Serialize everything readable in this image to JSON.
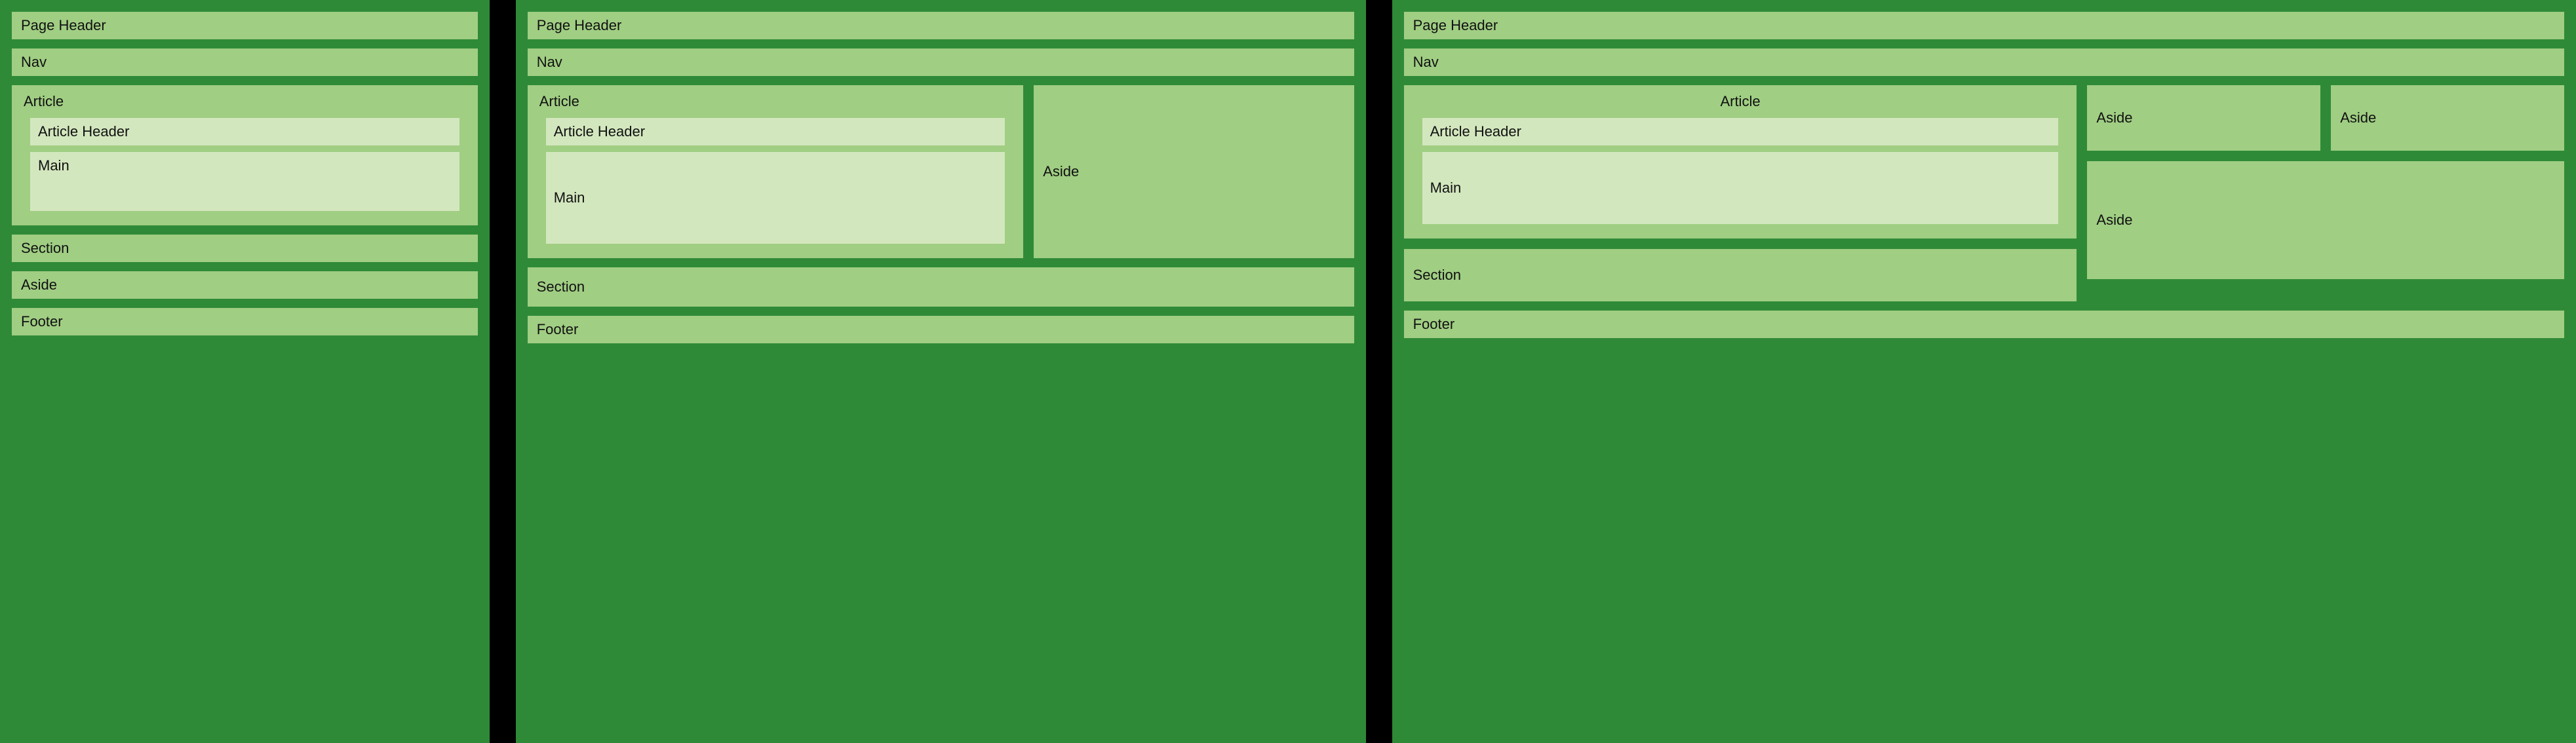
{
  "labels": {
    "pageHeader": "Page Header",
    "nav": "Nav",
    "article": "Article",
    "articleHeader": "Article Header",
    "main": "Main",
    "section": "Section",
    "aside": "Aside",
    "footer": "Footer"
  },
  "colors": {
    "panelBg": "#2f8a37",
    "blockBg": "#a0ce83",
    "innerBg": "#d3e7be",
    "divider": "#000000"
  },
  "diagram": {
    "description": "Three responsive layout wireframes showing how semantic page regions (header, nav, article with header and main, section, aside, footer) rearrange at narrow, medium, and wide viewport widths.",
    "panels": [
      {
        "width": "narrow",
        "stack": [
          "Page Header",
          "Nav",
          "Article(Article Header, Main)",
          "Section",
          "Aside",
          "Footer"
        ]
      },
      {
        "width": "medium",
        "stack": [
          "Page Header",
          "Nav",
          [
            "Article(Article Header, Main)",
            "Aside"
          ],
          "Section",
          "Footer"
        ]
      },
      {
        "width": "wide",
        "stack": [
          "Page Header",
          "Nav",
          [
            [
              "Article(Article Header, Main)",
              "Section"
            ],
            [
              [
                "Aside",
                "Aside"
              ],
              "Aside"
            ]
          ],
          "Footer"
        ]
      }
    ]
  }
}
